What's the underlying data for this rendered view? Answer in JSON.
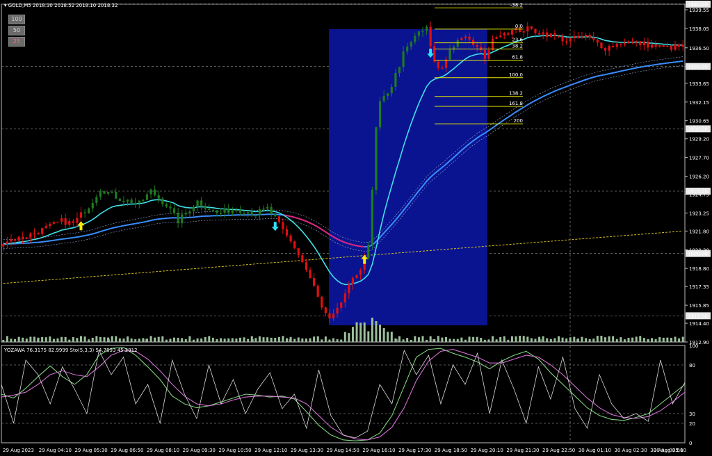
{
  "header": {
    "symbol": "GOLD,M5",
    "ohlc": "2018.30 2018.52 2018.10 2018.32",
    "indicator": "YOZAWA 76.3175 82.9999  Sto(5,3,3) 54.7893 45.2912"
  },
  "buttons": [
    {
      "label": "100",
      "color": "#6b6b6b"
    },
    {
      "label": "50",
      "color": "#6b6b6b"
    },
    {
      "label": "25",
      "color": "#6b6b6b"
    }
  ],
  "colors": {
    "bull": "#1f7a1f",
    "bear": "#e01010",
    "fast_ma": "#40e0e8",
    "slow_ma": "#3a8cff",
    "pink_ma": "#e0207a",
    "long_ma": "#d4c020",
    "box": "#0a1490",
    "fib": "#e8e800",
    "stoch_main": "#7fd07f",
    "stoch_signal": "#d070d0",
    "yozawa": "#d8d8d8",
    "arrow_up": "#ffe800",
    "arrow_down": "#30e0ff"
  },
  "chart_data": [
    {
      "type": "candlestick",
      "title": "GOLD,M5",
      "price_ticks": [
        "1939.55",
        "1938.05",
        "1936.50",
        "1935.00",
        "1933.65",
        "1932.15",
        "1930.65",
        "1929.20",
        "1927.70",
        "1926.20",
        "1924.75",
        "1923.25",
        "1921.80",
        "1920.30",
        "1918.80",
        "1917.35",
        "1915.85",
        "1914.40",
        "1912.90"
      ],
      "highlighted_levels": [
        "1940.00",
        "1935.00",
        "1930.00",
        "1925.00",
        "1920.00",
        "1915.00"
      ],
      "time_ticks": [
        "29 Aug 2023",
        "29 Aug 04:10",
        "29 Aug 05:30",
        "29 Aug 06:50",
        "29 Aug 08:10",
        "29 Aug 09:30",
        "29 Aug 10:50",
        "29 Aug 12:10",
        "29 Aug 13:30",
        "29 Aug 14:50",
        "29 Aug 16:10",
        "29 Aug 17:30",
        "29 Aug 18:50",
        "29 Aug 20:10",
        "29 Aug 21:30",
        "29 Aug 22:50",
        "30 Aug 01:10",
        "30 Aug 02:30",
        "30 Aug 03:50",
        "30 Aug 05:10"
      ],
      "ylim": [
        1912.9,
        1940.0
      ],
      "fib_levels": [
        {
          "label": "-38.2",
          "price": 1939.7
        },
        {
          "label": "0.0",
          "price": 1938.0
        },
        {
          "label": "23.6",
          "price": 1936.9
        },
        {
          "label": "38.2",
          "price": 1936.4
        },
        {
          "label": "61.8",
          "price": 1935.5
        },
        {
          "label": "100.0",
          "price": 1934.1
        },
        {
          "label": "138.2",
          "price": 1932.6
        },
        {
          "label": "161.8",
          "price": 1931.8
        },
        {
          "label": "200",
          "price": 1930.4
        }
      ],
      "price_path": [
        [
          0,
          1921.0
        ],
        [
          5,
          1921.3
        ],
        [
          10,
          1921.9
        ],
        [
          15,
          1922.6
        ],
        [
          18,
          1922.4
        ],
        [
          22,
          1923.8
        ],
        [
          25,
          1925.2
        ],
        [
          30,
          1924.4
        ],
        [
          35,
          1924.0
        ],
        [
          38,
          1925.0
        ],
        [
          42,
          1923.9
        ],
        [
          45,
          1922.6
        ],
        [
          50,
          1924.2
        ],
        [
          55,
          1923.2
        ],
        [
          60,
          1923.6
        ],
        [
          65,
          1923.2
        ],
        [
          68,
          1923.6
        ],
        [
          70,
          1922.8
        ],
        [
          72,
          1921.8
        ],
        [
          75,
          1920.5
        ],
        [
          78,
          1918.7
        ],
        [
          80,
          1917.3
        ],
        [
          82,
          1915.6
        ],
        [
          84,
          1914.6
        ],
        [
          86,
          1915.4
        ],
        [
          88,
          1916.8
        ],
        [
          90,
          1917.8
        ],
        [
          92,
          1918.9
        ],
        [
          94,
          1920.5
        ],
        [
          95,
          1925.0
        ],
        [
          96,
          1930.0
        ],
        [
          97,
          1932.0
        ],
        [
          100,
          1933.5
        ],
        [
          103,
          1936.0
        ],
        [
          107,
          1937.8
        ],
        [
          109,
          1938.0
        ],
        [
          111,
          1935.2
        ],
        [
          113,
          1934.8
        ],
        [
          115,
          1936.4
        ],
        [
          118,
          1937.4
        ],
        [
          121,
          1936.8
        ],
        [
          124,
          1935.8
        ],
        [
          127,
          1937.6
        ],
        [
          130,
          1937.8
        ],
        [
          135,
          1938.0
        ],
        [
          140,
          1937.6
        ],
        [
          145,
          1937.1
        ],
        [
          150,
          1937.4
        ],
        [
          155,
          1936.5
        ],
        [
          160,
          1937.0
        ],
        [
          165,
          1936.8
        ],
        [
          170,
          1936.5
        ],
        [
          175,
          1936.6
        ]
      ],
      "bear_ranges": [
        [
          0,
          20
        ],
        [
          71,
          93
        ],
        [
          110,
          114
        ],
        [
          118,
          127
        ],
        [
          128,
          175
        ]
      ],
      "arrows": [
        {
          "dir": "up",
          "index": 20,
          "price": 1922.2
        },
        {
          "dir": "down",
          "index": 70,
          "price": 1922.2
        },
        {
          "dir": "up",
          "index": 93,
          "price": 1919.5
        },
        {
          "dir": "down",
          "index": 110,
          "price": 1936.1
        }
      ]
    },
    {
      "type": "line",
      "title": "YOZAWA 76.3175 82.9999  Sto(5,3,3) 54.7893 45.2912",
      "ylim": [
        0,
        100
      ],
      "ticks": [
        "100",
        "80",
        "30",
        "20",
        "0"
      ],
      "levels": [
        80,
        30,
        20
      ],
      "series": [
        {
          "name": "Sto(5,3,3)",
          "role": "main",
          "values": [
            50,
            46,
            56,
            68,
            79,
            68,
            60,
            70,
            90,
            97,
            98,
            90,
            78,
            65,
            48,
            40,
            36,
            38,
            42,
            46,
            50,
            49,
            47,
            48,
            45,
            32,
            18,
            8,
            3,
            2,
            3,
            10,
            28,
            58,
            88,
            96,
            97,
            92,
            88,
            83,
            76,
            84,
            90,
            94,
            86,
            72,
            60,
            48,
            36,
            28,
            24,
            23,
            26,
            30,
            40,
            50,
            60
          ]
        },
        {
          "name": "",
          "role": "signal",
          "values": [
            47,
            49,
            52,
            60,
            70,
            74,
            70,
            68,
            78,
            90,
            95,
            94,
            86,
            74,
            60,
            48,
            40,
            38,
            40,
            44,
            47,
            48,
            48,
            47,
            46,
            40,
            28,
            16,
            8,
            4,
            3,
            6,
            16,
            36,
            64,
            84,
            94,
            96,
            92,
            88,
            82,
            82,
            86,
            90,
            88,
            80,
            70,
            58,
            46,
            36,
            29,
            26,
            25,
            27,
            33,
            42,
            52
          ]
        },
        {
          "name": "YOZAWA",
          "role": "oscillator",
          "values": [
            60,
            20,
            85,
            70,
            40,
            78,
            55,
            30,
            95,
            70,
            88,
            40,
            60,
            20,
            85,
            50,
            25,
            80,
            40,
            65,
            30,
            55,
            72,
            35,
            50,
            15,
            75,
            28,
            8,
            5,
            12,
            60,
            40,
            95,
            70,
            90,
            40,
            80,
            60,
            92,
            30,
            85,
            55,
            20,
            78,
            45,
            88,
            35,
            15,
            70,
            40,
            25,
            30,
            22,
            85,
            40,
            62
          ]
        }
      ]
    }
  ]
}
